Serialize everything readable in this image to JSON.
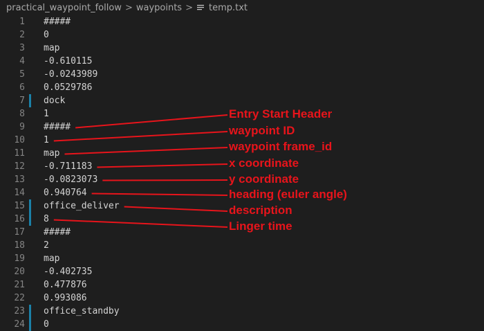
{
  "breadcrumb": {
    "items": [
      "practical_waypoint_follow",
      "waypoints",
      "temp.txt"
    ],
    "separator": ">"
  },
  "editor": {
    "lines": [
      {
        "num": "1",
        "text": "#####",
        "modified": false
      },
      {
        "num": "2",
        "text": "0",
        "modified": false
      },
      {
        "num": "3",
        "text": "map",
        "modified": false
      },
      {
        "num": "4",
        "text": "-0.610115",
        "modified": false
      },
      {
        "num": "5",
        "text": "-0.0243989",
        "modified": false
      },
      {
        "num": "6",
        "text": "0.0529786",
        "modified": false
      },
      {
        "num": "7",
        "text": "dock",
        "modified": true
      },
      {
        "num": "8",
        "text": "1",
        "modified": false
      },
      {
        "num": "9",
        "text": "#####",
        "modified": false
      },
      {
        "num": "10",
        "text": "1",
        "modified": false
      },
      {
        "num": "11",
        "text": "map",
        "modified": false
      },
      {
        "num": "12",
        "text": "-0.711183",
        "modified": false
      },
      {
        "num": "13",
        "text": "-0.0823073",
        "modified": false
      },
      {
        "num": "14",
        "text": "0.940764",
        "modified": false
      },
      {
        "num": "15",
        "text": "office_deliver",
        "modified": true
      },
      {
        "num": "16",
        "text": "8",
        "modified": true
      },
      {
        "num": "17",
        "text": "#####",
        "modified": false
      },
      {
        "num": "18",
        "text": "2",
        "modified": false
      },
      {
        "num": "19",
        "text": "map",
        "modified": false
      },
      {
        "num": "20",
        "text": "-0.402735",
        "modified": false
      },
      {
        "num": "21",
        "text": "0.477876",
        "modified": false
      },
      {
        "num": "22",
        "text": "0.993086",
        "modified": false
      },
      {
        "num": "23",
        "text": "office_standby",
        "modified": true
      },
      {
        "num": "24",
        "text": "0",
        "modified": true
      }
    ]
  },
  "annotations": [
    {
      "label": "Entry Start Header",
      "target_line": 9
    },
    {
      "label": "waypoint ID",
      "target_line": 10
    },
    {
      "label": "waypoint frame_id",
      "target_line": 11
    },
    {
      "label": "x coordinate",
      "target_line": 12
    },
    {
      "label": "y coordinate",
      "target_line": 13
    },
    {
      "label": "heading (euler angle)",
      "target_line": 14
    },
    {
      "label": "description",
      "target_line": 15
    },
    {
      "label": "Linger time",
      "target_line": 16
    }
  ],
  "colors": {
    "background": "#1e1e1e",
    "code_text": "#d4d4d4",
    "line_number": "#858585",
    "modified_marker": "#1b81a8",
    "annotation": "#e8141b"
  },
  "icons": {
    "file": "text-file-icon",
    "separator": "chevron-right-icon"
  }
}
